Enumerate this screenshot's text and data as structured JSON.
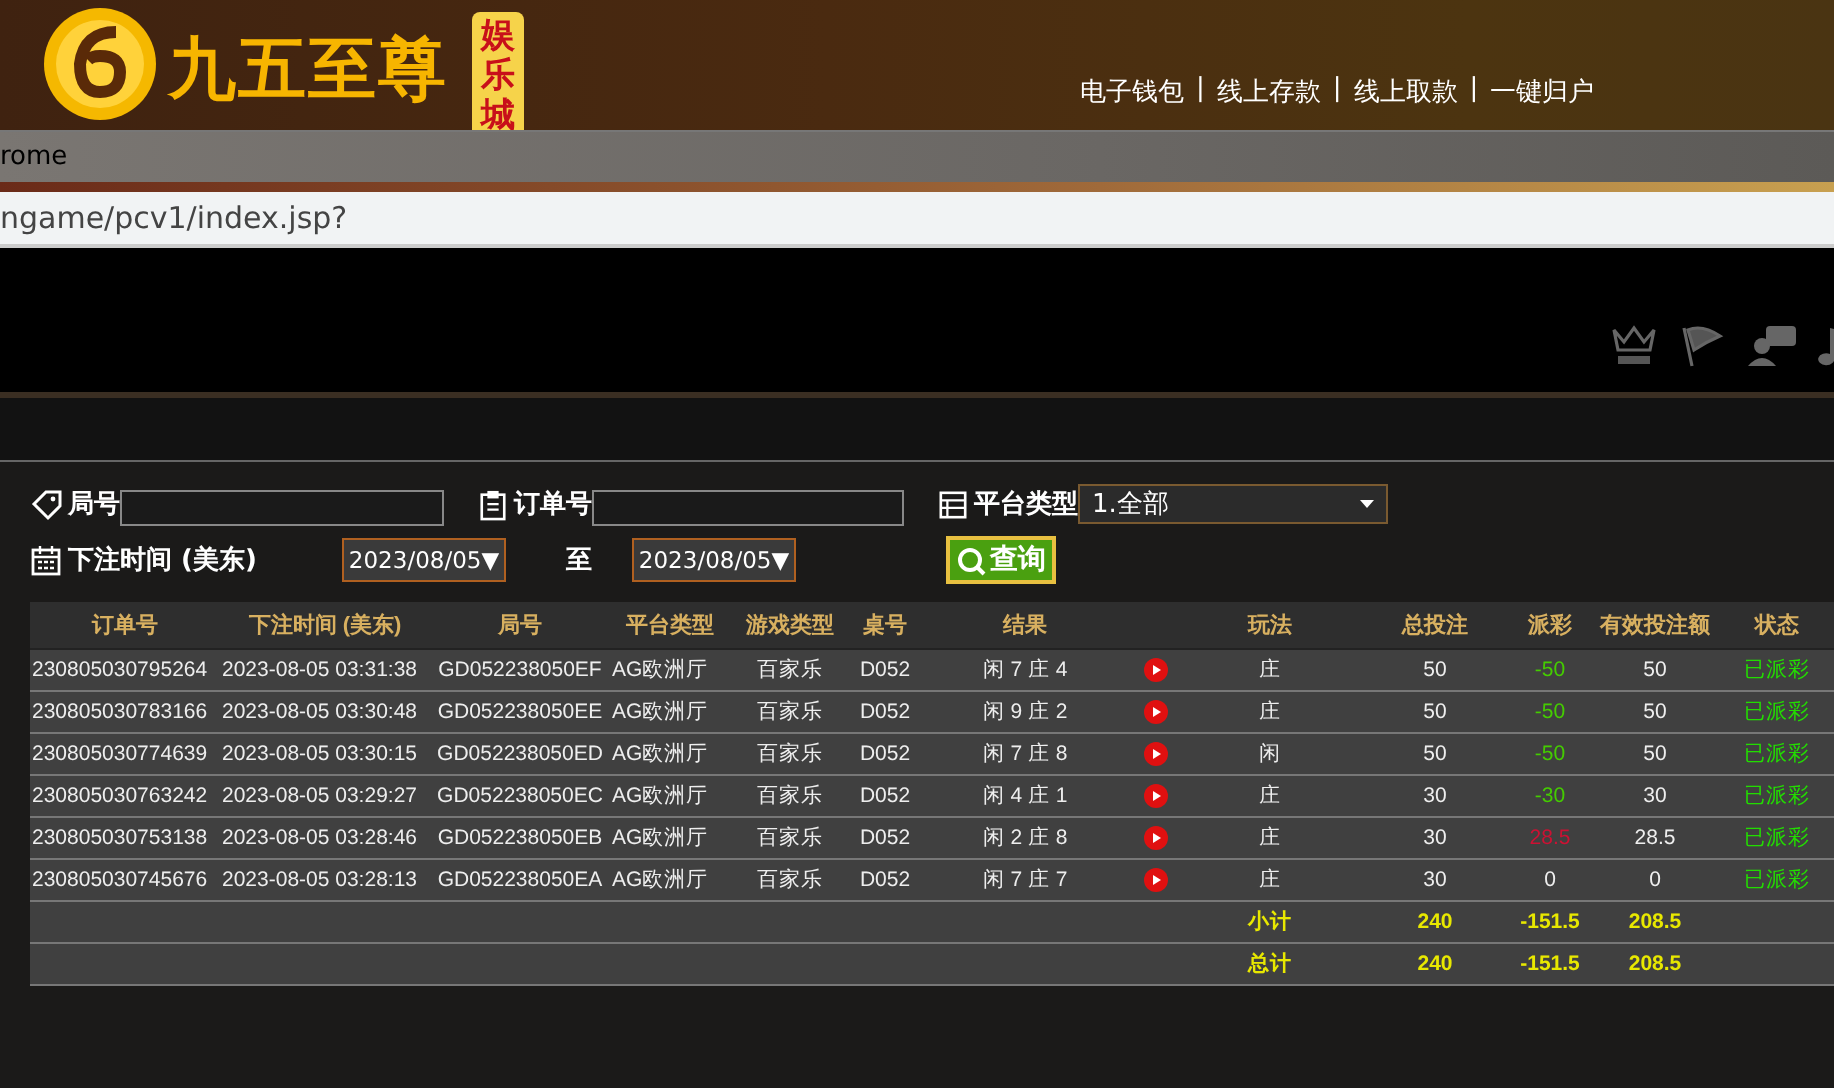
{
  "header": {
    "brand": "九五至尊",
    "badge": "娱乐城",
    "links": [
      "电子钱包",
      "线上存款",
      "线上取款",
      "一键归户"
    ],
    "separator": "|"
  },
  "browser": {
    "title": "rome",
    "address": "ngame/pcv1/index.jsp?"
  },
  "filters": {
    "round_label": "局号",
    "order_label": "订单号",
    "platform_label": "平台类型",
    "platform_value": "1.全部",
    "time_label": "下注时间 (美东)",
    "date_from": "2023/08/05▼",
    "to_label": "至",
    "date_to": "2023/08/05▼",
    "query_button": "查询"
  },
  "table": {
    "columns": [
      "订单号",
      "下注时间 (美东)",
      "局号",
      "平台类型",
      "游戏类型",
      "桌号",
      "结果",
      "",
      "玩法",
      "总投注",
      "派彩",
      "有效投注额",
      "状态"
    ],
    "rows": [
      {
        "order": "230805030795264",
        "time": "2023-08-05 03:31:38",
        "round": "GD052238050EF",
        "platform": "AG欧洲厅",
        "game": "百家乐",
        "table": "D052",
        "result": "闲 7 庄 4",
        "bet_on": "庄",
        "total": "50",
        "payout": "-50",
        "kind": "loss",
        "valid": "50",
        "status": "已派彩"
      },
      {
        "order": "230805030783166",
        "time": "2023-08-05 03:30:48",
        "round": "GD052238050EE",
        "platform": "AG欧洲厅",
        "game": "百家乐",
        "table": "D052",
        "result": "闲 9 庄 2",
        "bet_on": "庄",
        "total": "50",
        "payout": "-50",
        "kind": "loss",
        "valid": "50",
        "status": "已派彩"
      },
      {
        "order": "230805030774639",
        "time": "2023-08-05 03:30:15",
        "round": "GD052238050ED",
        "platform": "AG欧洲厅",
        "game": "百家乐",
        "table": "D052",
        "result": "闲 7 庄 8",
        "bet_on": "闲",
        "total": "50",
        "payout": "-50",
        "kind": "loss",
        "valid": "50",
        "status": "已派彩"
      },
      {
        "order": "230805030763242",
        "time": "2023-08-05 03:29:27",
        "round": "GD052238050EC",
        "platform": "AG欧洲厅",
        "game": "百家乐",
        "table": "D052",
        "result": "闲 4 庄 1",
        "bet_on": "庄",
        "total": "30",
        "payout": "-30",
        "kind": "loss",
        "valid": "30",
        "status": "已派彩"
      },
      {
        "order": "230805030753138",
        "time": "2023-08-05 03:28:46",
        "round": "GD052238050EB",
        "platform": "AG欧洲厅",
        "game": "百家乐",
        "table": "D052",
        "result": "闲 2 庄 8",
        "bet_on": "庄",
        "total": "30",
        "payout": "28.5",
        "kind": "win",
        "valid": "28.5",
        "status": "已派彩"
      },
      {
        "order": "230805030745676",
        "time": "2023-08-05 03:28:13",
        "round": "GD052238050EA",
        "platform": "AG欧洲厅",
        "game": "百家乐",
        "table": "D052",
        "result": "闲 7 庄 7",
        "bet_on": "庄",
        "total": "30",
        "payout": "0",
        "kind": "even",
        "valid": "0",
        "status": "已派彩"
      }
    ],
    "summary": [
      {
        "label": "小计",
        "total": "240",
        "payout": "-151.5",
        "valid": "208.5"
      },
      {
        "label": "总计",
        "total": "240",
        "payout": "-151.5",
        "valid": "208.5"
      }
    ]
  }
}
